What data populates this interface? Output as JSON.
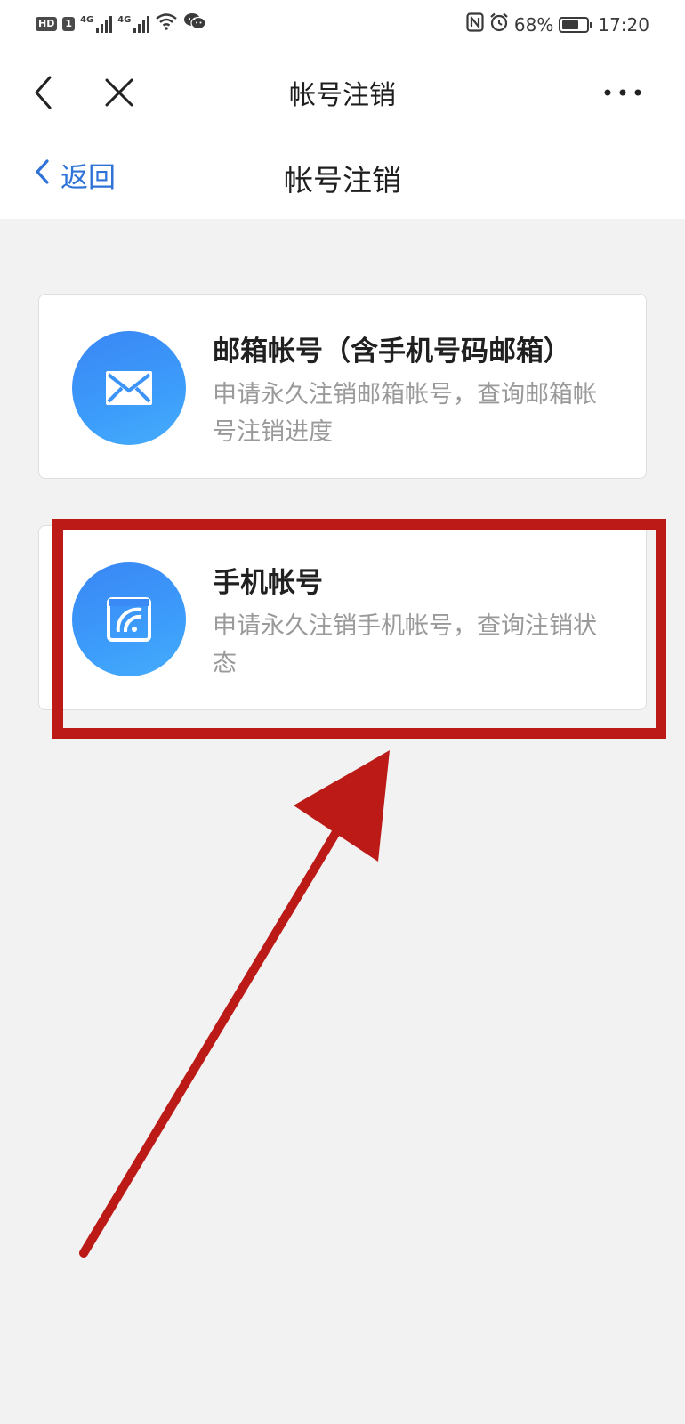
{
  "status_bar": {
    "hd_badge": "HD",
    "sim_badge": "1",
    "signal_1_tag": "4G",
    "signal_2_tag": "4G",
    "battery_percent": "68%",
    "battery_level": 0.68,
    "time": "17:20",
    "icons": [
      "hd-icon",
      "sim-icon",
      "signal-4g-icon",
      "signal-4g-icon",
      "wifi-icon",
      "wechat-icon",
      "nfc-icon",
      "alarm-icon",
      "battery-icon"
    ]
  },
  "top_nav": {
    "title": "帐号注销",
    "back_icon": "chevron-left-icon",
    "close_icon": "close-icon",
    "more_icon": "more-dots-icon"
  },
  "sub_header": {
    "back_label": "返回",
    "title": "帐号注销"
  },
  "cards": [
    {
      "title": "邮箱帐号（含手机号码邮箱）",
      "description": "申请永久注销邮箱帐号，查询邮箱帐号注销进度",
      "icon": "envelope-icon"
    },
    {
      "title": "手机帐号",
      "description": "申请永久注销手机帐号，查询注销状态",
      "icon": "phone-signal-icon"
    }
  ],
  "colors": {
    "accent_blue": "#2f73d8",
    "icon_blue": "#3c9cfb",
    "annotation_red": "#bb1a17",
    "background": "#f2f2f2"
  }
}
